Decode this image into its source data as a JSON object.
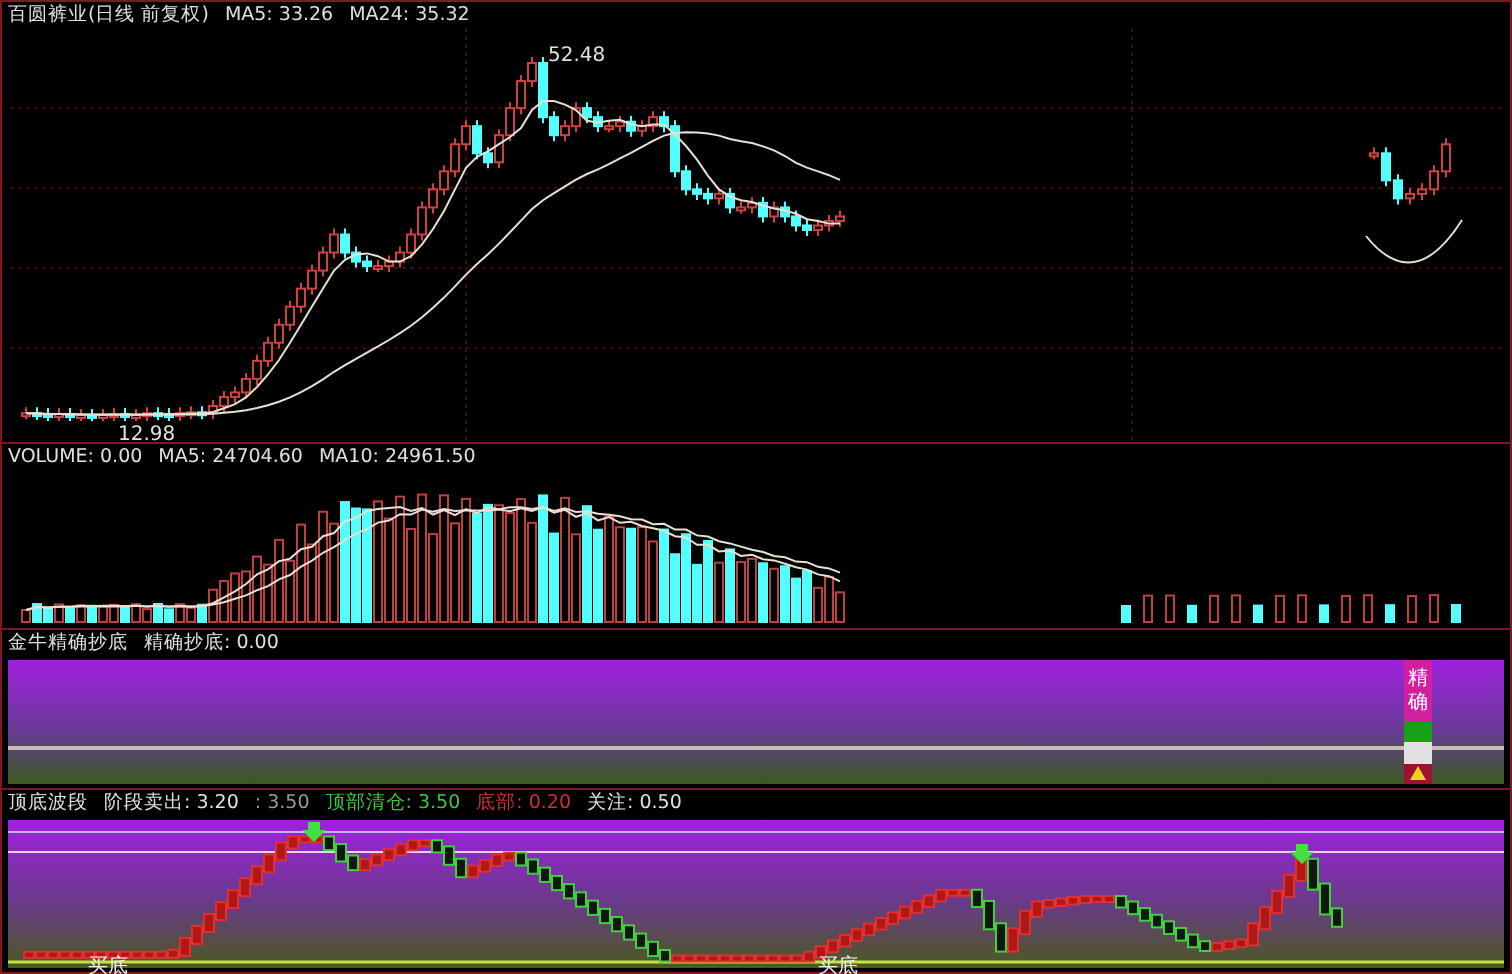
{
  "price_panel": {
    "title": "百圆裤业(日线 前复权)",
    "indicators": [
      "MA5: 33.26",
      "MA24: 35.32"
    ],
    "high_label": "52.48",
    "low_label": "12.98"
  },
  "volume_panel": {
    "indicators": [
      "VOLUME: 0.00",
      "MA5: 24704.60",
      "MA10: 24961.50"
    ]
  },
  "bottom_finder_panel": {
    "title": "金牛精确抄底",
    "indicators": [
      "精确抄底: 0.00"
    ],
    "signal_labels": [
      "精",
      "确"
    ]
  },
  "wave_panel": {
    "title": "顶底波段",
    "indicators": [
      {
        "text": "阶段卖出: 3.20",
        "color": "#e0e0e0"
      },
      {
        "text": ": 3.50",
        "color": "#9a9a9a"
      },
      {
        "text": "顶部清仓: 3.50",
        "color": "#3cc83c"
      },
      {
        "text": "底部: 0.20",
        "color": "#c83232"
      },
      {
        "text": "关注: 0.50",
        "color": "#e0e0e0"
      }
    ],
    "buy_labels": [
      "买底",
      "买底"
    ]
  }
}
